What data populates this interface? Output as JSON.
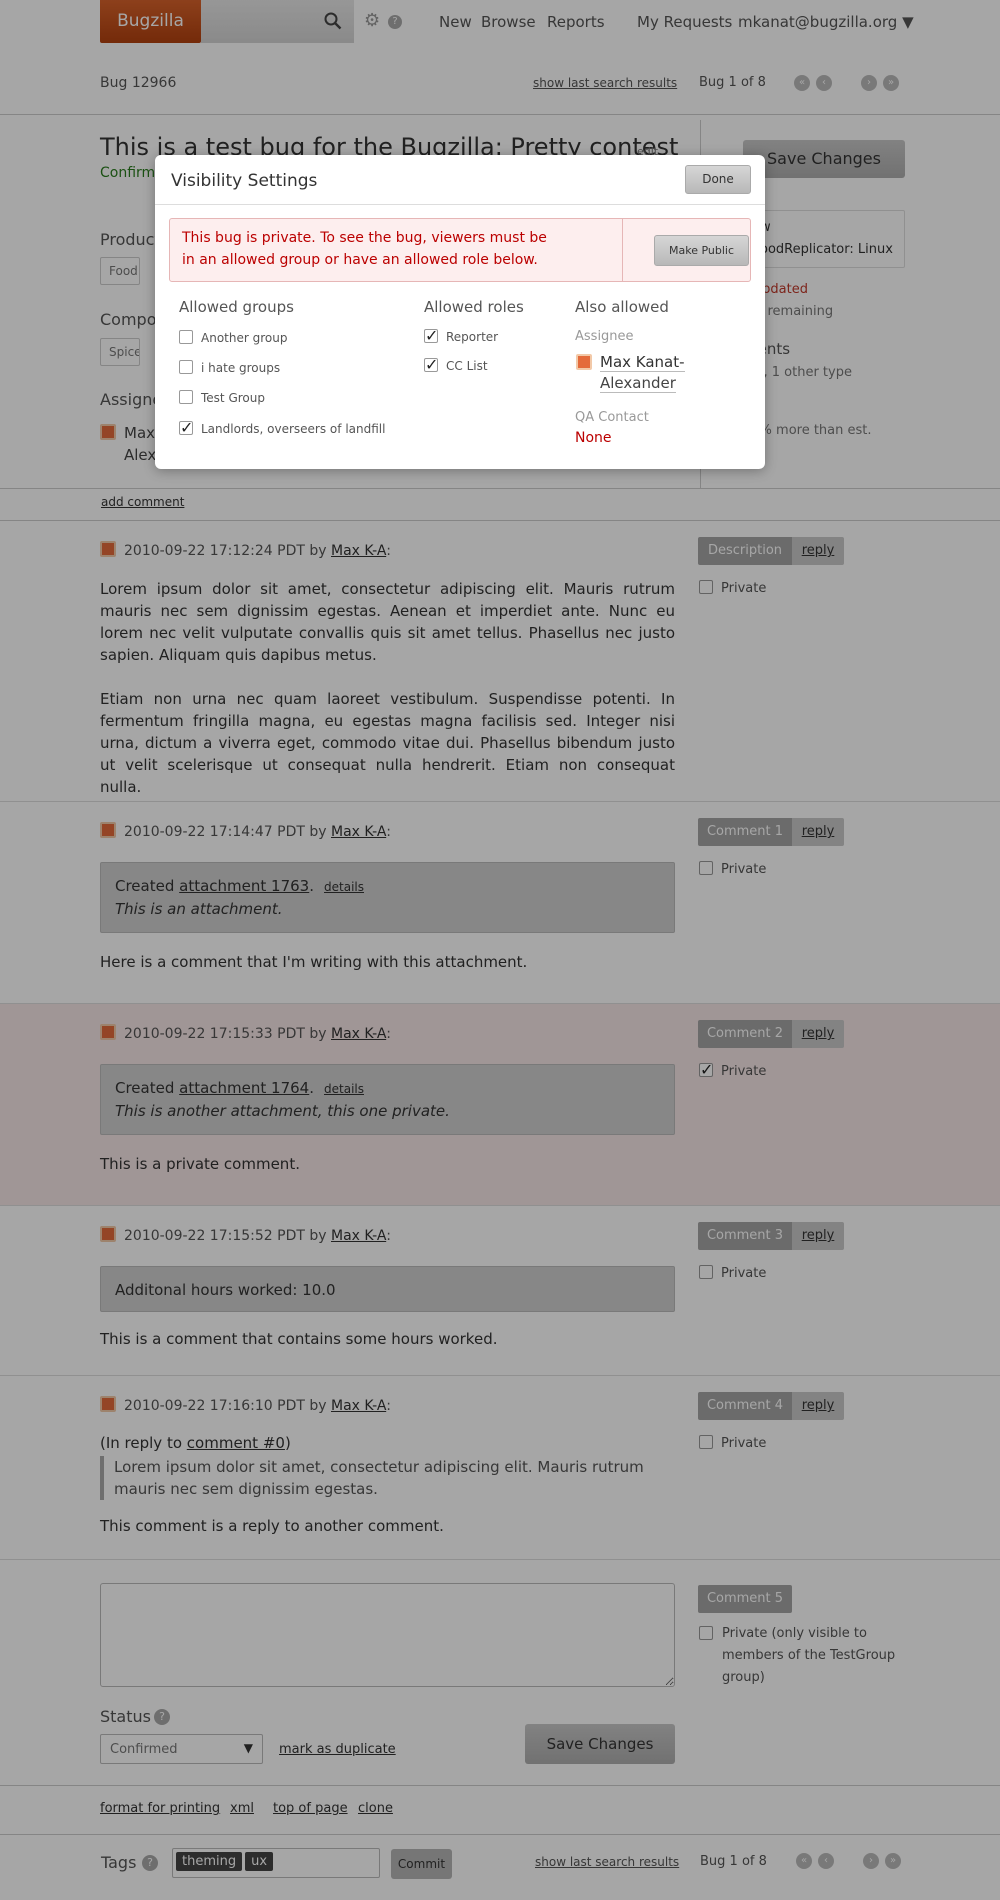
{
  "header": {
    "logo": "Bugzilla",
    "nav": [
      "New",
      "Browse",
      "Reports"
    ],
    "my_requests": "My Requests",
    "user": "mkanat@bugzilla.org ▼"
  },
  "bugnav": {
    "bug_id": "Bug 12966",
    "show_last": "show last search results",
    "position": "Bug 1 of 8"
  },
  "bug": {
    "title": "This is a test bug for the Bugzilla: Pretty contest",
    "edit": "edit",
    "status_line": "Confirm",
    "save_label": "Save Changes",
    "product_label": "Product",
    "product_value": "Food Re",
    "component_label": "Compon",
    "component_value": "Spice D",
    "assignee_label": "Assigne",
    "assignee_short1": "Max",
    "assignee_short2": "Alex"
  },
  "right_panel": {
    "line1": "w",
    "line2": "oodReplicator: Linux",
    "updated_prefix": "s",
    "updated": "updated",
    "hours_remaining": "urs remaining",
    "comments": "ments",
    "comments_sub": "tch, 1 other type",
    "estimate": "10% more than est."
  },
  "add_comment": "add comment",
  "comments": [
    {
      "time": "2010-09-22 17:12:24 PDT by",
      "author": "Max K-A",
      "tag": "Description",
      "reply": "reply",
      "private_label": "Private",
      "private": false,
      "body1": "Lorem ipsum dolor sit amet, consectetur adipiscing elit. Mauris rutrum mauris nec sem dignissim egestas. Aenean et imperdiet ante. Nunc eu lorem nec velit vulputate convallis quis sit amet tellus. Phasellus nec justo sapien. Aliquam quis dapibus metus.",
      "body2": "Etiam non urna nec quam laoreet vestibulum. Suspendisse potenti. In fermentum fringilla magna, eu egestas magna facilisis sed. Integer nisi urna, dictum a viverra eget, commodo vitae dui. Phasellus bibendum justo ut velit scelerisque ut consequat nulla hendrerit. Etiam non consequat nulla."
    },
    {
      "time": "2010-09-22 17:14:47 PDT by",
      "author": "Max K-A",
      "tag": "Comment 1",
      "reply": "reply",
      "private_label": "Private",
      "private": false,
      "attach_created": "Created",
      "attach_link": "attachment 1763",
      "attach_details": "details",
      "attach_desc": "This is an attachment.",
      "body": "Here is a comment that I'm writing with this attachment."
    },
    {
      "time": "2010-09-22 17:15:33 PDT by",
      "author": "Max K-A",
      "tag": "Comment 2",
      "reply": "reply",
      "private_label": "Private",
      "private": true,
      "attach_created": "Created",
      "attach_link": "attachment 1764",
      "attach_details": "details",
      "attach_desc": "This is another attachment, this one private.",
      "body": "This is a private comment."
    },
    {
      "time": "2010-09-22 17:15:52 PDT by",
      "author": "Max K-A",
      "tag": "Comment 3",
      "reply": "reply",
      "private_label": "Private",
      "private": false,
      "hours": "Additonal hours worked: 10.0",
      "body": "This is a comment that contains some hours worked."
    },
    {
      "time": "2010-09-22 17:16:10 PDT by",
      "author": "Max K-A",
      "tag": "Comment 4",
      "reply": "reply",
      "private_label": "Private",
      "private": false,
      "reply_prefix": "(In reply to",
      "reply_link": "comment #0",
      "reply_suffix": ")",
      "quote": "Lorem ipsum dolor sit amet, consectetur adipiscing elit. Mauris rutrum mauris nec sem dignissim egestas.",
      "body": "This comment is a reply to another comment."
    }
  ],
  "new_comment": {
    "tag": "Comment 5",
    "private_label": "Private (only visible to members of the TestGroup group)",
    "status_label": "Status",
    "status_value": "Confirmed",
    "mark_duplicate": "mark as duplicate",
    "save_label": "Save Changes"
  },
  "footer": {
    "links": [
      "format for printing",
      "xml",
      "top of page",
      "clone"
    ],
    "tags_label": "Tags",
    "tags": [
      "theming",
      "ux"
    ],
    "commit": "Commit",
    "show_last": "show last search results",
    "position": "Bug 1 of 8"
  },
  "modal": {
    "title": "Visibility Settings",
    "done": "Done",
    "alert": "This bug is private.  To see the bug, viewers must be in an allowed group or have an allowed role below.",
    "make_public": "Make Public",
    "groups_heading": "Allowed groups",
    "groups": [
      {
        "label": "Another group",
        "checked": false
      },
      {
        "label": "i hate groups",
        "checked": false
      },
      {
        "label": "Test Group",
        "checked": false
      },
      {
        "label": "Landlords, overseers of landfill",
        "checked": true
      }
    ],
    "roles_heading": "Allowed roles",
    "roles": [
      {
        "label": "Reporter",
        "checked": true
      },
      {
        "label": "CC List",
        "checked": true
      }
    ],
    "also_heading": "Also allowed",
    "assignee_label": "Assignee",
    "assignee_line1": "Max Kanat-",
    "assignee_line2": "Alexander",
    "qa_label": "QA Contact",
    "qa_value": "None"
  },
  "colors": {
    "brand": "#c5521d",
    "alert_text": "#bb0000",
    "status_green": "#2a7d1e",
    "private_row": "#f6e6e6"
  }
}
